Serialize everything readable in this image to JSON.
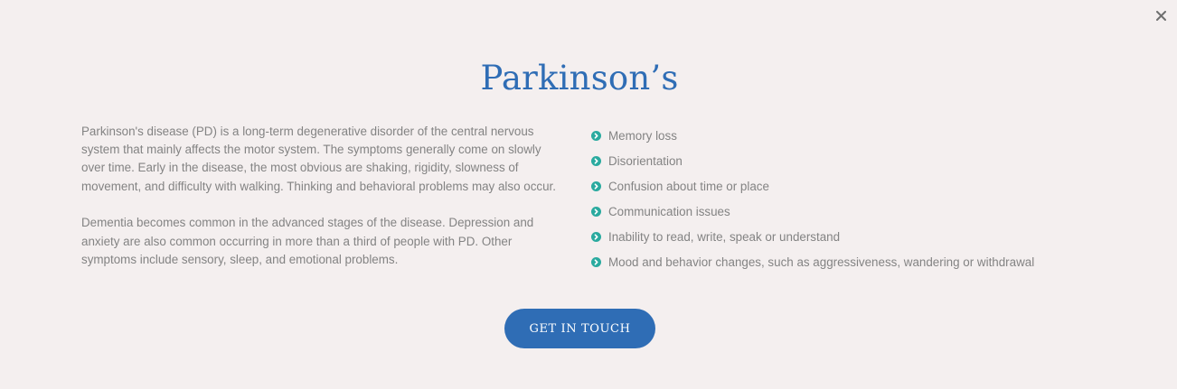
{
  "modal": {
    "title": "Parkinson’s",
    "close_icon": "close-icon",
    "description": [
      "Parkinson's disease (PD) is a long-term degenerative disorder of the central nervous system that mainly affects the motor system. The symptoms generally come on slowly over time. Early in the disease, the most obvious are shaking, rigidity, slowness of movement, and difficulty with walking. Thinking and behavioral problems may also occur.",
      "Dementia becomes common in the advanced stages of the disease. Depression and anxiety are also common occurring in more than a third of people with PD. Other symptoms include sensory, sleep, and emotional problems."
    ],
    "symptoms": [
      "Memory loss",
      "Disorientation",
      "Confusion about time or place",
      "Communication issues",
      "Inability to read, write, speak or understand",
      "Mood and behavior changes, such as aggressiveness, wandering or withdrawal"
    ],
    "bullet_icon": "chevron-circle-right-icon",
    "cta_label": "GET IN TOUCH"
  },
  "colors": {
    "background": "#f4efef",
    "accent": "#2f6db5",
    "bullet": "#2aaa9f",
    "text": "#838383",
    "close": "#6f6f6f"
  }
}
